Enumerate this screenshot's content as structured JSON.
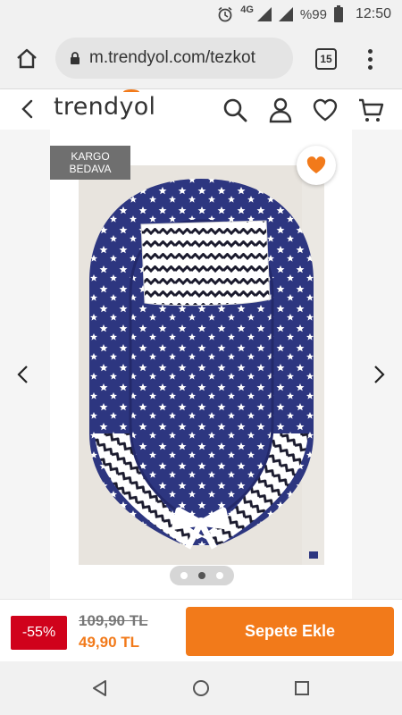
{
  "status_bar": {
    "network": "4G",
    "battery": "%99",
    "time": "12:50"
  },
  "browser": {
    "url": "m.trendyol.com/tezkot",
    "tab_count": "15"
  },
  "site": {
    "logo": "trendyol",
    "accent_color": "#f27a1a"
  },
  "product": {
    "badge_line1": "KARGO",
    "badge_line2": "BEDAVA",
    "gallery_dot_count": 3,
    "active_dot": 2
  },
  "buy_bar": {
    "discount": "-55%",
    "old_price": "109,90 TL",
    "new_price": "49,90 TL",
    "cart_button": "Sepete Ekle"
  }
}
